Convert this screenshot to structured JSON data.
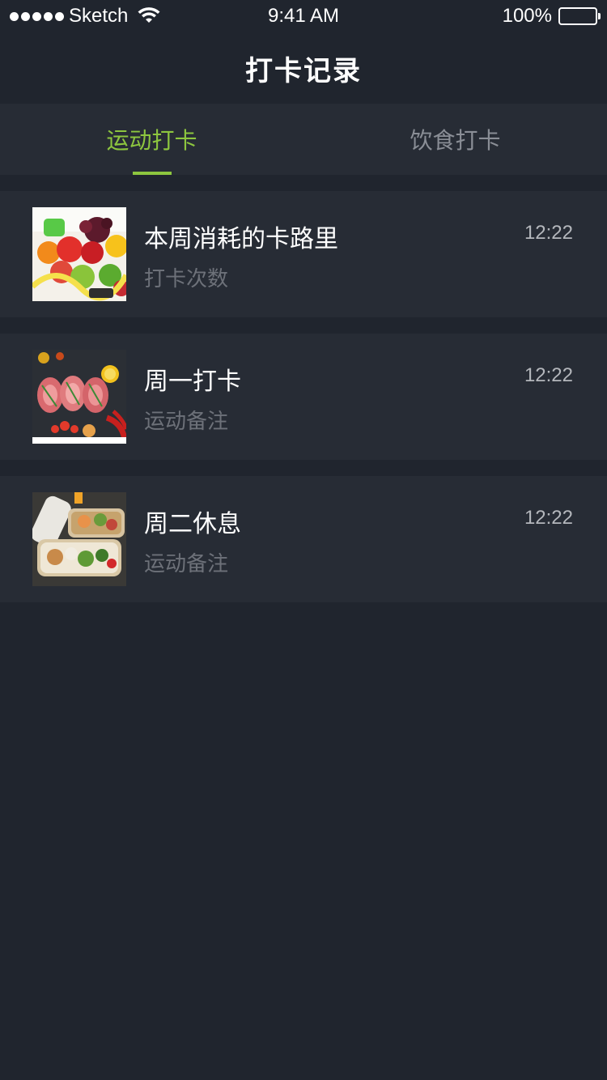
{
  "status_bar": {
    "carrier": "Sketch",
    "time": "9:41 AM",
    "battery": "100%"
  },
  "nav": {
    "title": "打卡记录"
  },
  "tabs": [
    {
      "label": "运动打卡",
      "active": true
    },
    {
      "label": "饮食打卡",
      "active": false
    }
  ],
  "items": [
    {
      "title": "本周消耗的卡路里",
      "subtitle": "打卡次数",
      "time": "12:22",
      "image": "fruit-dumbbell-photo"
    },
    {
      "title": "周一打卡",
      "subtitle": "运动备注",
      "time": "12:22",
      "image": "meat-vegetables-photo"
    },
    {
      "title": "周二休息",
      "subtitle": "运动备注",
      "time": "12:22",
      "image": "meal-box-photo"
    }
  ],
  "colors": {
    "background": "#20252e",
    "card": "#272c35",
    "accent": "#8dc63f",
    "muted_text": "#6d7179",
    "inactive_tab": "#8a8e96"
  }
}
